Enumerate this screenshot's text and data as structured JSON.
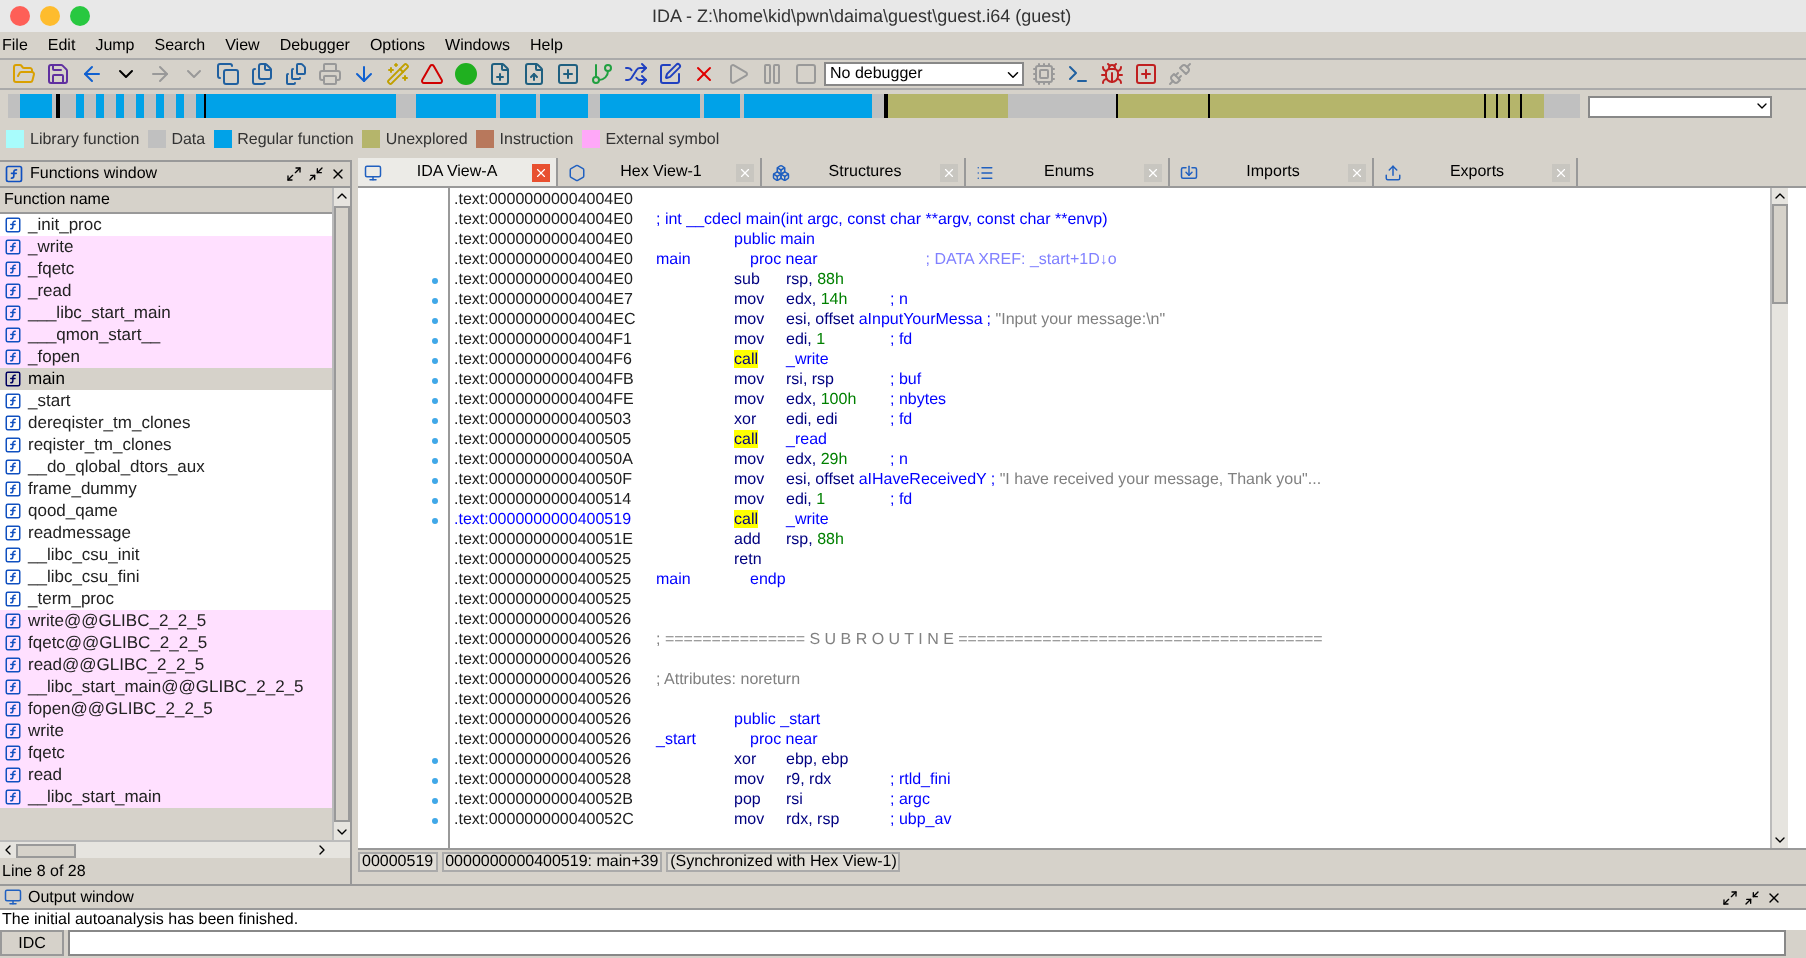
{
  "window": {
    "title": "IDA - Z:\\home\\kid\\pwn\\daima\\guest\\guest.i64 (guest)"
  },
  "menu": [
    "File",
    "Edit",
    "Jump",
    "Search",
    "View",
    "Debugger",
    "Options",
    "Windows",
    "Help"
  ],
  "toolbar": {
    "debugger": "No debugger"
  },
  "legend": [
    {
      "label": "Library function",
      "color": "#a8fcfc"
    },
    {
      "label": "Data",
      "color": "#c0c0c0"
    },
    {
      "label": "Regular function",
      "color": "#00a2e8"
    },
    {
      "label": "Unexplored",
      "color": "#b5b56b"
    },
    {
      "label": "Instruction",
      "color": "#b8785c"
    },
    {
      "label": "External symbol",
      "color": "#ffa8f8"
    }
  ],
  "functions_window": {
    "title": "Functions window",
    "column": "Function name",
    "status": "Line 8 of 28",
    "items": [
      {
        "name": "_init_proc",
        "kind": "regular",
        "selected": false
      },
      {
        "name": "_write",
        "kind": "external",
        "selected": false
      },
      {
        "name": "_fqetc",
        "kind": "external",
        "selected": false
      },
      {
        "name": "_read",
        "kind": "external",
        "selected": false
      },
      {
        "name": "___libc_start_main",
        "kind": "external",
        "selected": false
      },
      {
        "name": "___qmon_start__",
        "kind": "external",
        "selected": false
      },
      {
        "name": "_fopen",
        "kind": "external",
        "selected": false
      },
      {
        "name": "main",
        "kind": "regular",
        "selected": true
      },
      {
        "name": "_start",
        "kind": "regular",
        "selected": false
      },
      {
        "name": "dereqister_tm_clones",
        "kind": "regular",
        "selected": false
      },
      {
        "name": "reqister_tm_clones",
        "kind": "regular",
        "selected": false
      },
      {
        "name": "__do_qlobal_dtors_aux",
        "kind": "regular",
        "selected": false
      },
      {
        "name": "frame_dummy",
        "kind": "regular",
        "selected": false
      },
      {
        "name": "qood_qame",
        "kind": "regular",
        "selected": false
      },
      {
        "name": "readmessage",
        "kind": "regular",
        "selected": false
      },
      {
        "name": "__libc_csu_init",
        "kind": "regular",
        "selected": false
      },
      {
        "name": "__libc_csu_fini",
        "kind": "regular",
        "selected": false
      },
      {
        "name": "_term_proc",
        "kind": "regular",
        "selected": false
      },
      {
        "name": "write@@GLIBC_2_2_5",
        "kind": "external",
        "selected": false
      },
      {
        "name": "fqetc@@GLIBC_2_2_5",
        "kind": "external",
        "selected": false
      },
      {
        "name": "read@@GLIBC_2_2_5",
        "kind": "external",
        "selected": false
      },
      {
        "name": "__libc_start_main@@GLIBC_2_2_5",
        "kind": "external",
        "selected": false
      },
      {
        "name": "fopen@@GLIBC_2_2_5",
        "kind": "external",
        "selected": false
      },
      {
        "name": "write",
        "kind": "external",
        "selected": false
      },
      {
        "name": "fqetc",
        "kind": "external",
        "selected": false
      },
      {
        "name": "read",
        "kind": "external",
        "selected": false
      },
      {
        "name": "__libc_start_main",
        "kind": "external",
        "selected": false
      }
    ]
  },
  "tabs": [
    {
      "label": "IDA View-A",
      "selected": true
    },
    {
      "label": "Hex View-1",
      "selected": false
    },
    {
      "label": "Structures",
      "selected": false
    },
    {
      "label": "Enums",
      "selected": false
    },
    {
      "label": "Imports",
      "selected": false
    },
    {
      "label": "Exports",
      "selected": false
    }
  ],
  "disassembly": {
    "lines": [
      {
        "address": ".text:00000000004004E0",
        "current": false,
        "flow": false
      },
      {
        "address": ".text:00000000004004E0",
        "current": false,
        "flow": false,
        "remark": [
          {
            "text": "; int __cdecl main(int argc, const char **argv, const char **envp)",
            "kind": "cmt"
          }
        ]
      },
      {
        "address": ".text:00000000004004E0",
        "current": false,
        "flow": false,
        "mnemonic": "public main",
        "kind": "directive"
      },
      {
        "address": ".text:00000000004004E0",
        "current": false,
        "flow": false,
        "label": "main",
        "mnemonic": "proc near",
        "kind": "proc",
        "comment": [
          {
            "text": "; DATA XREF: _start+1D↓o",
            "kind": "xref"
          }
        ]
      },
      {
        "address": ".text:00000000004004E0",
        "current": false,
        "flow": true,
        "mnemonic": "sub",
        "kind": "instruction",
        "operands": [
          {
            "text": "rsp, ",
            "kind": "reg"
          },
          {
            "text": "88h",
            "kind": "num"
          }
        ]
      },
      {
        "address": ".text:00000000004004E7",
        "current": false,
        "flow": true,
        "mnemonic": "mov",
        "kind": "instruction",
        "operands": [
          {
            "text": "edx, ",
            "kind": "reg"
          },
          {
            "text": "14h",
            "kind": "num"
          }
        ],
        "comment": [
          {
            "text": "; n",
            "kind": "cmt"
          }
        ]
      },
      {
        "address": ".text:00000000004004EC",
        "current": false,
        "flow": true,
        "mnemonic": "mov",
        "kind": "instruction",
        "operands": [
          {
            "text": "esi, offset ",
            "kind": "reg"
          },
          {
            "text": "aInputYourMessa",
            "kind": "name"
          }
        ],
        "comment": [
          {
            "text": "; ",
            "kind": "cmt"
          },
          {
            "text": "\"Input your message:\\n\"",
            "kind": "str"
          }
        ]
      },
      {
        "address": ".text:00000000004004F1",
        "current": false,
        "flow": true,
        "mnemonic": "mov",
        "kind": "instruction",
        "operands": [
          {
            "text": "edi, ",
            "kind": "reg"
          },
          {
            "text": "1",
            "kind": "num"
          }
        ],
        "comment": [
          {
            "text": "; fd",
            "kind": "cmt"
          }
        ]
      },
      {
        "address": ".text:00000000004004F6",
        "current": false,
        "flow": true,
        "mnemonic": "call",
        "kind": "call",
        "operands": [
          {
            "text": "_write",
            "kind": "name"
          }
        ]
      },
      {
        "address": ".text:00000000004004FB",
        "current": false,
        "flow": true,
        "mnemonic": "mov",
        "kind": "instruction",
        "operands": [
          {
            "text": "rsi, rsp",
            "kind": "reg"
          }
        ],
        "comment": [
          {
            "text": "; buf",
            "kind": "cmt"
          }
        ]
      },
      {
        "address": ".text:00000000004004FE",
        "current": false,
        "flow": true,
        "mnemonic": "mov",
        "kind": "instruction",
        "operands": [
          {
            "text": "edx, ",
            "kind": "reg"
          },
          {
            "text": "100h",
            "kind": "num"
          }
        ],
        "comment": [
          {
            "text": "; nbytes",
            "kind": "cmt"
          }
        ]
      },
      {
        "address": ".text:0000000000400503",
        "current": false,
        "flow": true,
        "mnemonic": "xor",
        "kind": "instruction",
        "operands": [
          {
            "text": "edi, edi",
            "kind": "reg"
          }
        ],
        "comment": [
          {
            "text": "; fd",
            "kind": "cmt"
          }
        ]
      },
      {
        "address": ".text:0000000000400505",
        "current": false,
        "flow": true,
        "mnemonic": "call",
        "kind": "call",
        "operands": [
          {
            "text": "_read",
            "kind": "name"
          }
        ]
      },
      {
        "address": ".text:000000000040050A",
        "current": false,
        "flow": true,
        "mnemonic": "mov",
        "kind": "instruction",
        "operands": [
          {
            "text": "edx, ",
            "kind": "reg"
          },
          {
            "text": "29h",
            "kind": "num"
          }
        ],
        "comment": [
          {
            "text": "; n",
            "kind": "cmt"
          }
        ]
      },
      {
        "address": ".text:000000000040050F",
        "current": false,
        "flow": true,
        "mnemonic": "mov",
        "kind": "instruction",
        "operands": [
          {
            "text": "esi, offset ",
            "kind": "reg"
          },
          {
            "text": "aIHaveReceivedY",
            "kind": "name"
          }
        ],
        "comment": [
          {
            "text": "; ",
            "kind": "cmt"
          },
          {
            "text": "\"I have received your message, Thank you\"...",
            "kind": "str"
          }
        ]
      },
      {
        "address": ".text:0000000000400514",
        "current": false,
        "flow": true,
        "mnemonic": "mov",
        "kind": "instruction",
        "operands": [
          {
            "text": "edi, ",
            "kind": "reg"
          },
          {
            "text": "1",
            "kind": "num"
          }
        ],
        "comment": [
          {
            "text": "; fd",
            "kind": "cmt"
          }
        ]
      },
      {
        "address": ".text:0000000000400519",
        "current": true,
        "flow": true,
        "mnemonic": "call",
        "kind": "call",
        "operands": [
          {
            "text": "_write",
            "kind": "name"
          }
        ]
      },
      {
        "address": ".text:000000000040051E",
        "current": false,
        "flow": false,
        "mnemonic": "add",
        "kind": "instruction",
        "operands": [
          {
            "text": "rsp, ",
            "kind": "reg"
          },
          {
            "text": "88h",
            "kind": "num"
          }
        ]
      },
      {
        "address": ".text:0000000000400525",
        "current": false,
        "flow": false,
        "mnemonic": "retn",
        "kind": "instruction"
      },
      {
        "address": ".text:0000000000400525",
        "current": false,
        "flow": false,
        "label": "main",
        "mnemonic": "endp",
        "kind": "proc"
      },
      {
        "address": ".text:0000000000400525",
        "current": false,
        "flow": false
      },
      {
        "address": ".text:0000000000400526",
        "current": false,
        "flow": false
      },
      {
        "address": ".text:0000000000400526",
        "current": false,
        "flow": false,
        "remark": [
          {
            "text": "; =============== S U B R O U T I N E =======================================",
            "kind": "sep"
          }
        ]
      },
      {
        "address": ".text:0000000000400526",
        "current": false,
        "flow": false
      },
      {
        "address": ".text:0000000000400526",
        "current": false,
        "flow": false,
        "remark": [
          {
            "text": "; Attributes: noreturn",
            "kind": "sep"
          }
        ]
      },
      {
        "address": ".text:0000000000400526",
        "current": false,
        "flow": false
      },
      {
        "address": ".text:0000000000400526",
        "current": false,
        "flow": false,
        "mnemonic": "public _start",
        "kind": "directive"
      },
      {
        "address": ".text:0000000000400526",
        "current": false,
        "flow": false,
        "label": "_start",
        "mnemonic": "proc near",
        "kind": "proc"
      },
      {
        "address": ".text:0000000000400526",
        "current": false,
        "flow": true,
        "mnemonic": "xor",
        "kind": "instruction",
        "operands": [
          {
            "text": "ebp, ebp",
            "kind": "reg"
          }
        ]
      },
      {
        "address": ".text:0000000000400528",
        "current": false,
        "flow": true,
        "mnemonic": "mov",
        "kind": "instruction",
        "operands": [
          {
            "text": "r9, rdx",
            "kind": "reg"
          }
        ],
        "comment": [
          {
            "text": "; rtld_fini",
            "kind": "cmt"
          }
        ]
      },
      {
        "address": ".text:000000000040052B",
        "current": false,
        "flow": true,
        "mnemonic": "pop",
        "kind": "instruction",
        "operands": [
          {
            "text": "rsi",
            "kind": "reg"
          }
        ],
        "comment": [
          {
            "text": "; argc",
            "kind": "cmt"
          }
        ]
      },
      {
        "address": ".text:000000000040052C",
        "current": false,
        "flow": true,
        "mnemonic": "mov",
        "kind": "instruction",
        "operands": [
          {
            "text": "rdx, rsp",
            "kind": "reg"
          }
        ],
        "comment": [
          {
            "text": "; ubp_av",
            "kind": "cmt"
          }
        ]
      }
    ],
    "status": [
      "00000519",
      "0000000000400519: main+39",
      "(Synchronized with Hex View-1)"
    ]
  },
  "output_window": {
    "title": "Output window",
    "text": "The initial autoanalysis has been finished.",
    "prompt": "IDC"
  }
}
